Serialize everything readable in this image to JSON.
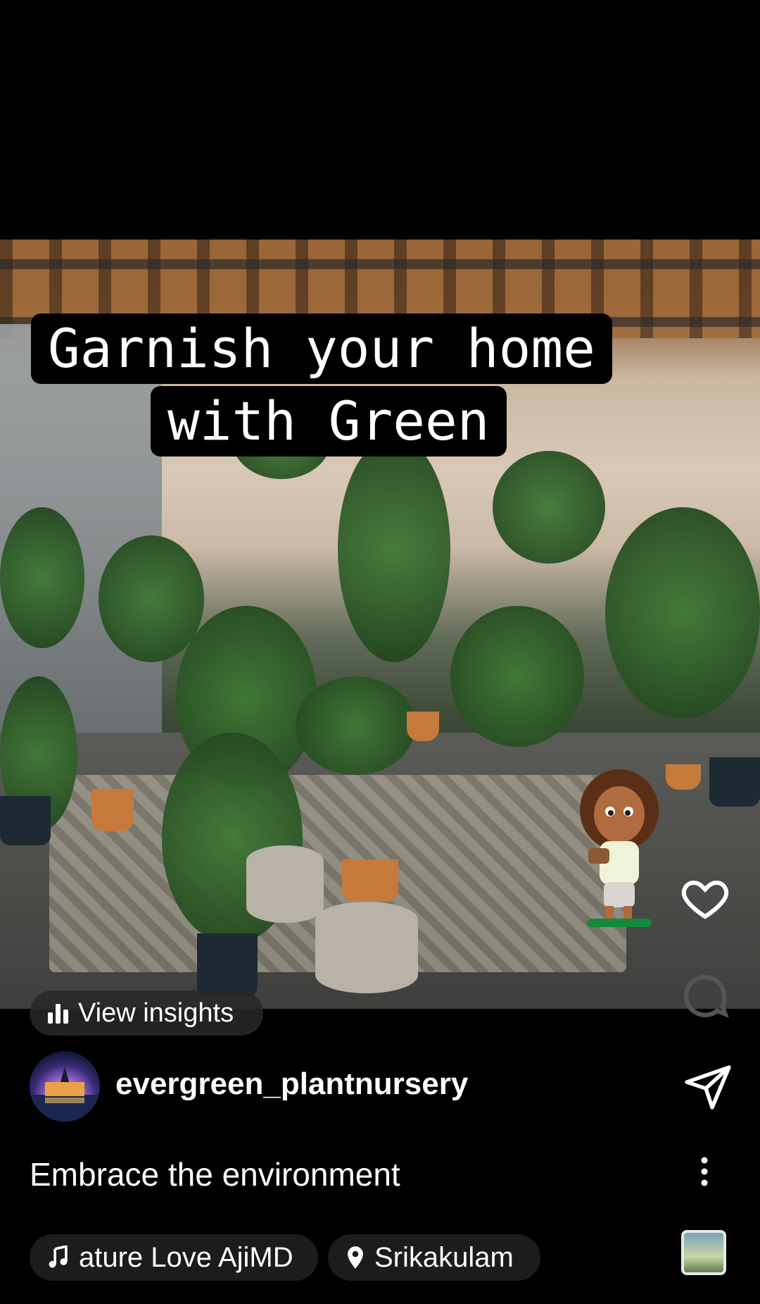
{
  "post": {
    "caption_line1": "Garnish your home",
    "caption_line2": "with Green",
    "insights_label": "View insights"
  },
  "author": {
    "username": "evergreen_plantnursery",
    "avatar_icon": "avatar-image"
  },
  "description": "Embrace the environment",
  "audio": {
    "label": "ature Love   AjiMD"
  },
  "location": {
    "label": "Srikakulam"
  },
  "icons": {
    "like": "heart-icon",
    "comment": "comment-icon",
    "share": "send-icon",
    "more": "more-vertical-icon",
    "music": "music-note-icon",
    "location": "location-pin-icon",
    "insights": "bar-chart-icon"
  },
  "colors": {
    "background": "#000000",
    "pill_background": "#1c1c1c",
    "text": "#ffffff"
  }
}
